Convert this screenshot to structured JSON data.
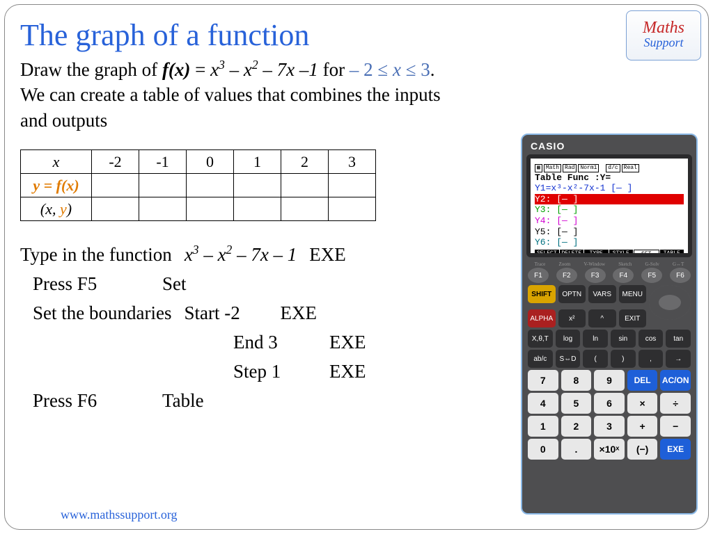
{
  "title": "The graph of a function",
  "prompt_parts": {
    "draw": "Draw the graph of ",
    "fx": "f(x)",
    "eq": " = ",
    "poly_html": "x³ – x² – 7x –1",
    "for": " for ",
    "domain": "– 2 ≤ x ≤ 3",
    "period": ".",
    "line2": "We can create a table of values that combines the inputs and outputs"
  },
  "table": {
    "row_x_label": "x",
    "x_values": [
      "-2",
      "-1",
      "0",
      "1",
      "2",
      "3"
    ],
    "row_fx_label": "y = f(x)",
    "row_xy_x": "(x, ",
    "row_xy_y": "y",
    "row_xy_close": ")"
  },
  "instructions": {
    "typein": "Type in the function",
    "poly": "x³ – x² – 7x – 1",
    "exe": "EXE",
    "pressF5": "Press F5",
    "set": "Set",
    "setbound": "Set the boundaries",
    "start": "Start -2",
    "end": "End 3",
    "step": "Step 1",
    "pressF6": "Press F6",
    "table": "Table"
  },
  "footer": "www.mathssupport.org",
  "logo": {
    "l1": "Maths",
    "l2": "Support"
  },
  "calc": {
    "brand": "CASIO",
    "screen": {
      "header": "Table Func   :Y=",
      "y1": "Y1=x³-x²-7x-1   [— ]",
      "y2": "Y2:                 [— ]",
      "y3": "Y3:                 [— ]",
      "y4": "Y4:                 [— ]",
      "y5": "Y5:                 [— ]",
      "y6": "Y6:                 [— ]",
      "menu": [
        "SELECT",
        "DELETE",
        "TYPE",
        "STYLE",
        "SET",
        "TABLE"
      ]
    },
    "frow_labels": [
      "Trace",
      "Zoom",
      "V-Window",
      "Sketch",
      "G-Solv",
      "G↔T"
    ],
    "fkeys": [
      "F1",
      "F2",
      "F3",
      "F4",
      "F5",
      "F6"
    ],
    "row2": [
      "SHIFT",
      "OPTN",
      "VARS",
      "MENU"
    ],
    "row3": [
      "ALPHA",
      "x²",
      "^",
      "EXIT"
    ],
    "row4": [
      "X,θ,T",
      "log",
      "ln",
      "sin",
      "cos",
      "tan"
    ],
    "row5": [
      "ab/c",
      "S⇔D",
      "(",
      ")",
      ",",
      "→"
    ],
    "numrows": [
      [
        "7",
        "8",
        "9",
        "DEL",
        "AC/ON"
      ],
      [
        "4",
        "5",
        "6",
        "×",
        "÷"
      ],
      [
        "1",
        "2",
        "3",
        "+",
        "−"
      ],
      [
        "0",
        ".",
        "×10ˣ",
        "(−)",
        "EXE"
      ]
    ]
  }
}
